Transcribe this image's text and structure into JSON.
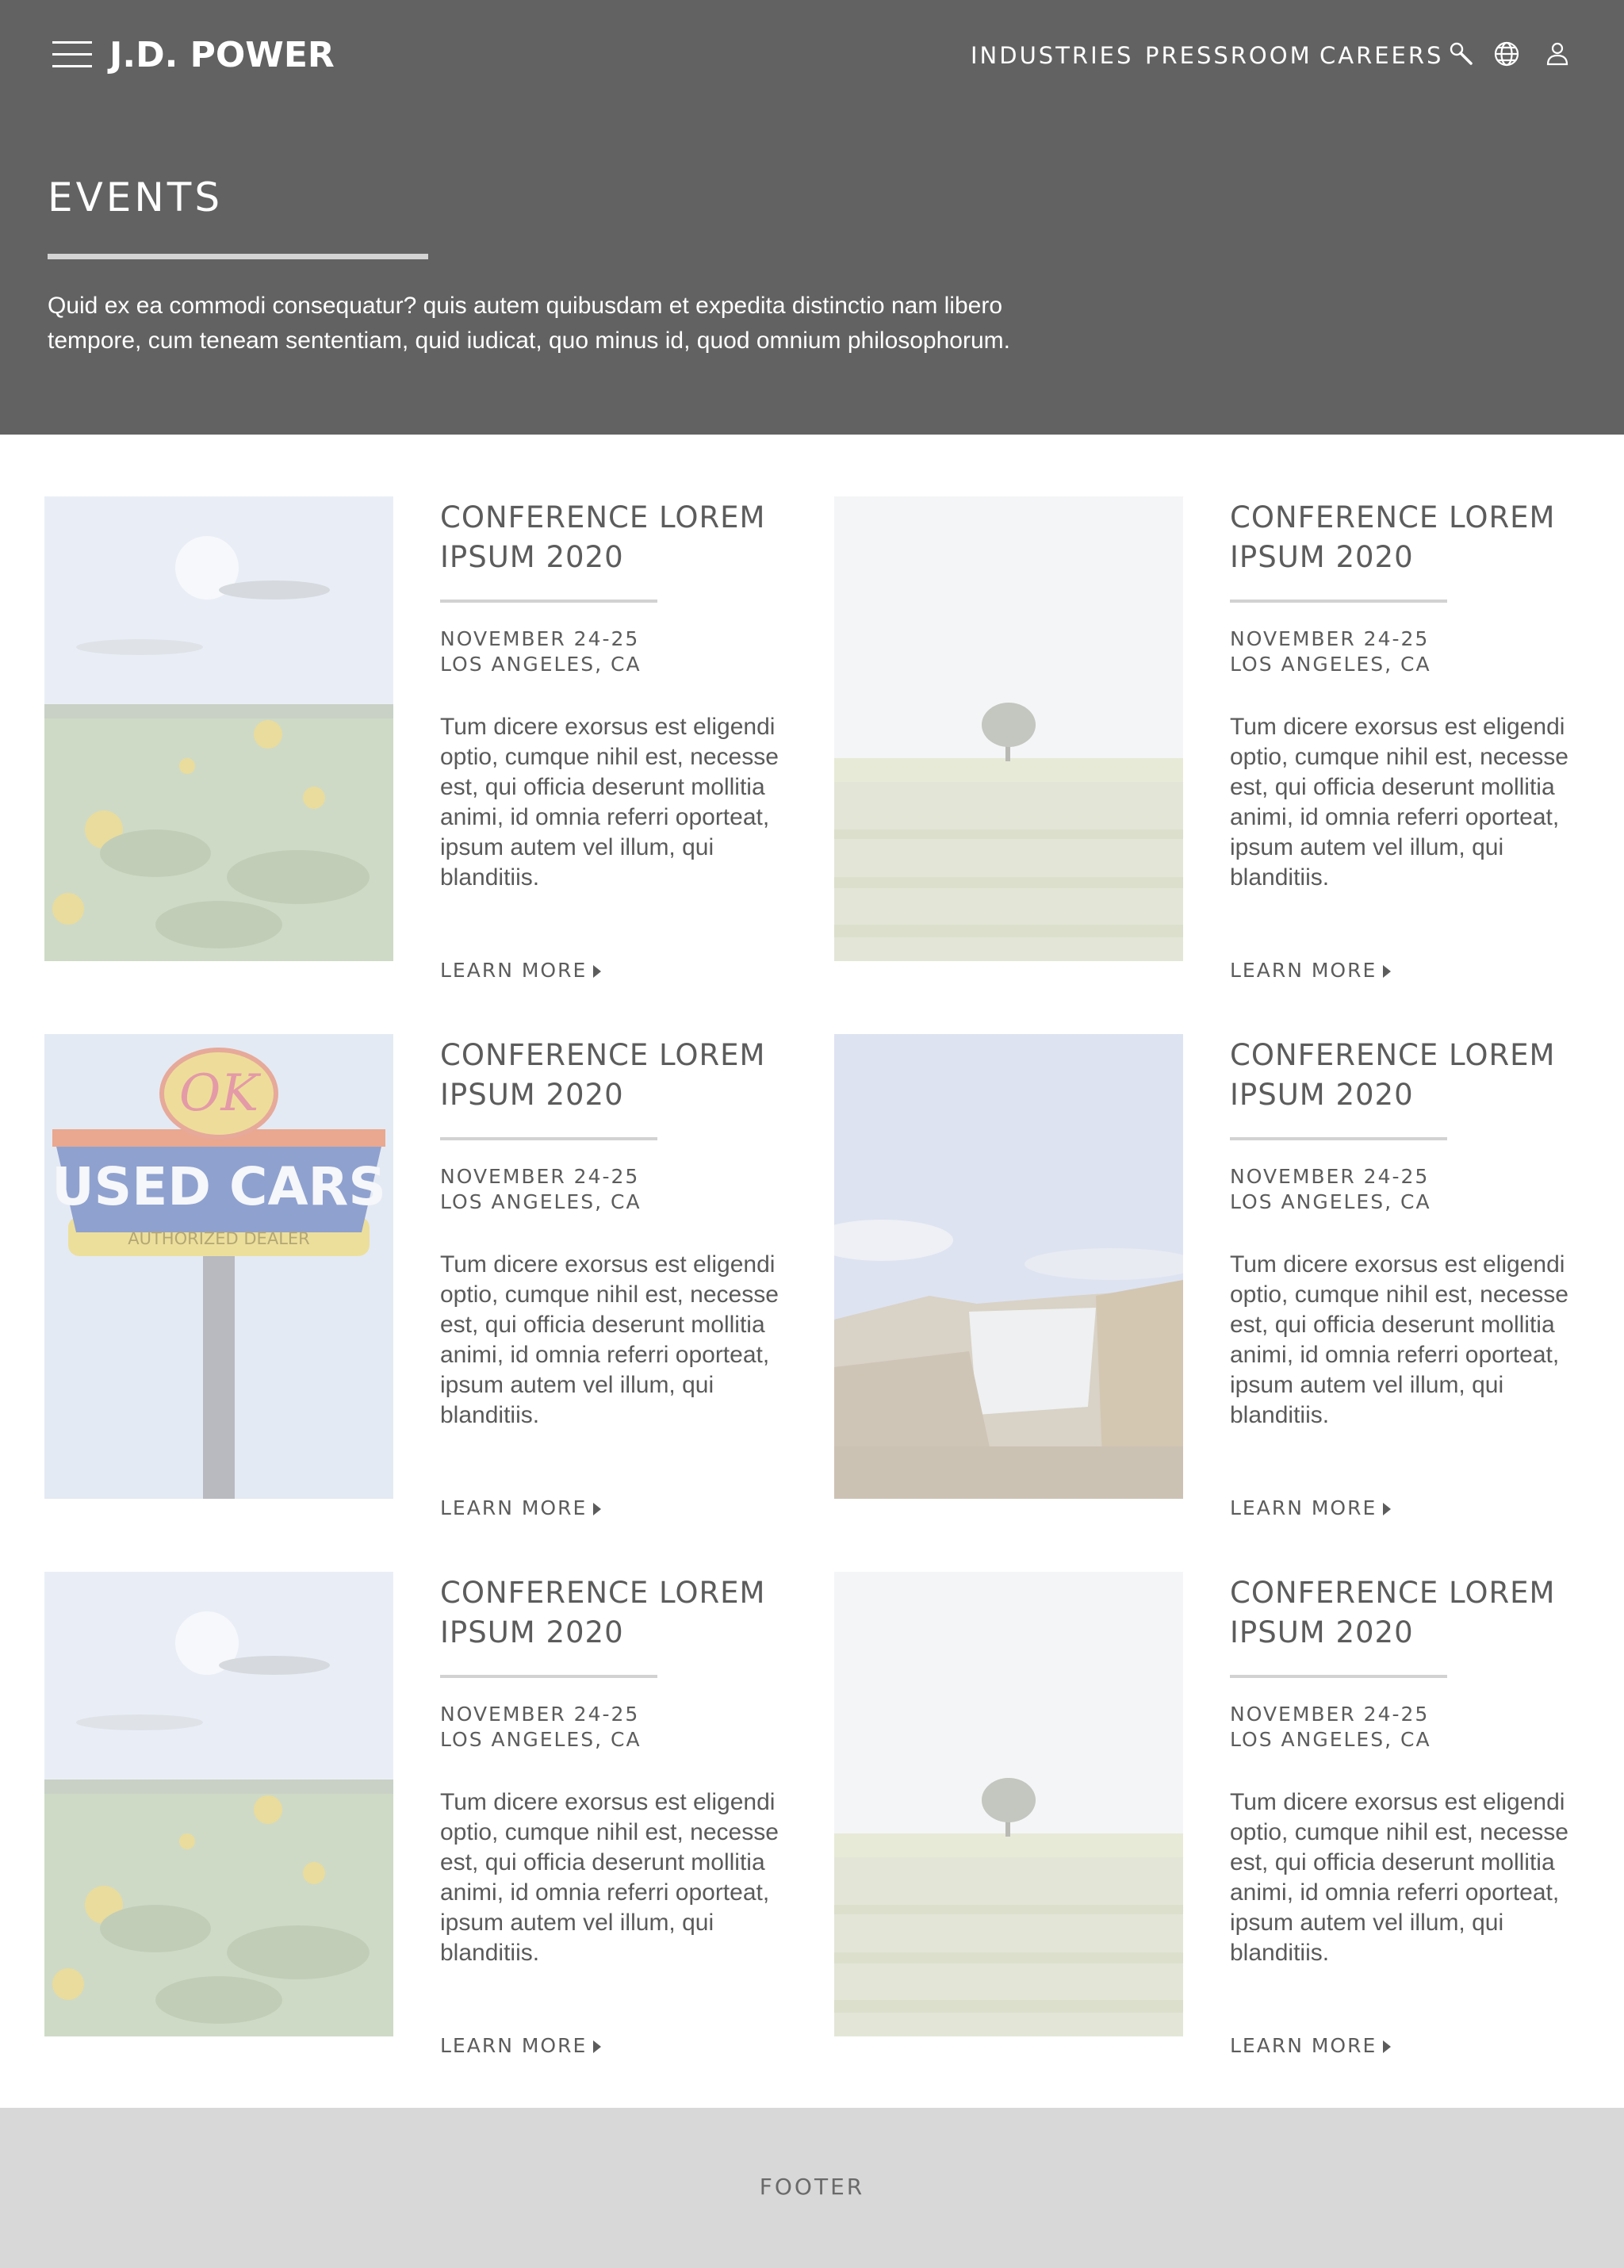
{
  "header": {
    "logo": "J.D. POWER",
    "nav": {
      "industries": "INDUSTRIES",
      "pressroom": "PRESSROOM",
      "careers": "CAREERS"
    },
    "icons": [
      "menu-icon",
      "search-icon",
      "globe-icon",
      "user-icon"
    ]
  },
  "hero": {
    "title": "EVENTS",
    "description": "Quid ex ea commodi consequatur? quis autem quibusdam et expedita distinctio nam libero tempore, cum teneam sententiam, quid iudicat, quo minus id, quod omnium philosophorum."
  },
  "events": [
    {
      "image": "sunflower-field",
      "title": "CONFERENCE LOREM IPSUM 2020",
      "date": "NOVEMBER 24-25",
      "location": "LOS ANGELES, CA",
      "text": "Tum dicere exorsus est eligendi optio, cumque nihil est, necesse est, qui officia deserunt mollitia animi, id omnia referri oporteat, ipsum autem vel illum, qui blanditiis.",
      "link": "LEARN MORE"
    },
    {
      "image": "lone-tree-field",
      "title": "CONFERENCE LOREM IPSUM 2020",
      "date": "NOVEMBER 24-25",
      "location": "LOS ANGELES, CA",
      "text": "Tum dicere exorsus est eligendi optio, cumque nihil est, necesse est, qui officia deserunt mollitia animi, id omnia referri oporteat, ipsum autem vel illum, qui blanditiis.",
      "link": "LEARN MORE"
    },
    {
      "image": "used-cars-sign",
      "sign_top": "OK",
      "sign_main": "USED CARS",
      "sign_bottom": "AUTHORIZED DEALER",
      "title": "CONFERENCE LOREM IPSUM 2020",
      "date": "NOVEMBER 24-25",
      "location": "LOS ANGELES, CA",
      "text": "Tum dicere exorsus est eligendi optio, cumque nihil est, necesse est, qui officia deserunt mollitia animi, id omnia referri oporteat, ipsum autem vel illum, qui blanditiis.",
      "link": "LEARN MORE"
    },
    {
      "image": "waterfall-cliff",
      "title": "CONFERENCE LOREM IPSUM 2020",
      "date": "NOVEMBER 24-25",
      "location": "LOS ANGELES, CA",
      "text": "Tum dicere exorsus est eligendi optio, cumque nihil est, necesse est, qui officia deserunt mollitia animi, id omnia referri oporteat, ipsum autem vel illum, qui blanditiis.",
      "link": "LEARN MORE"
    },
    {
      "image": "sunflower-field",
      "title": "CONFERENCE LOREM IPSUM 2020",
      "date": "NOVEMBER 24-25",
      "location": "LOS ANGELES, CA",
      "text": "Tum dicere exorsus est eligendi optio, cumque nihil est, necesse est, qui officia deserunt mollitia animi, id omnia referri oporteat, ipsum autem vel illum, qui blanditiis.",
      "link": "LEARN MORE"
    },
    {
      "image": "lone-tree-field",
      "title": "CONFERENCE LOREM IPSUM 2020",
      "date": "NOVEMBER 24-25",
      "location": "LOS ANGELES, CA",
      "text": "Tum dicere exorsus est eligendi optio, cumque nihil est, necesse est, qui officia deserunt mollitia animi, id omnia referri oporteat, ipsum autem vel illum, qui blanditiis.",
      "link": "LEARN MORE"
    }
  ],
  "footer": {
    "label": "FOOTER"
  },
  "colors": {
    "hero_bg": "#626262",
    "text": "#5c5c5c",
    "footer_bg": "#d8d8d8",
    "rule": "#d2d2d2"
  }
}
